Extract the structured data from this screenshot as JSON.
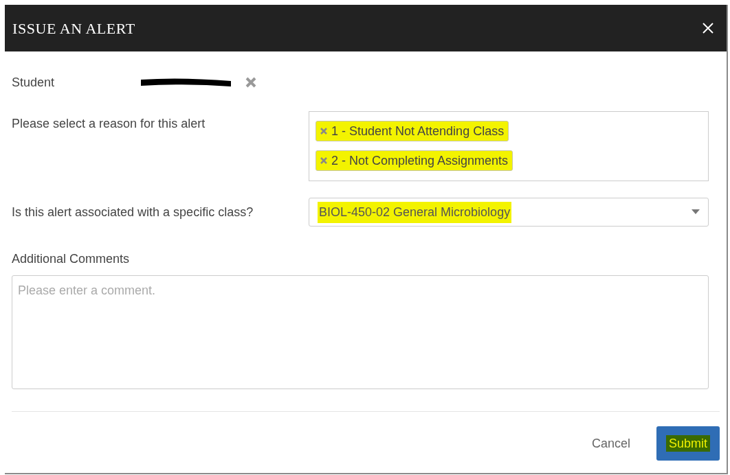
{
  "dialog": {
    "title": "ISSUE AN ALERT"
  },
  "student": {
    "label": "Student",
    "redacted": true
  },
  "reason": {
    "label": "Please select a reason for this alert",
    "tags": [
      {
        "label": "1 - Student Not Attending Class",
        "highlighted": true
      },
      {
        "label": "2 - Not Completing Assignments",
        "highlighted": true
      }
    ]
  },
  "class_select": {
    "label": "Is this alert associated with a specific class?",
    "value": "BIOL-450-02 General Microbiology",
    "highlighted": true
  },
  "comments": {
    "label": "Additional Comments",
    "placeholder": "Please enter a comment."
  },
  "buttons": [
    {
      "kind": "link",
      "label": "Cancel",
      "highlighted": false
    },
    {
      "kind": "primary",
      "label": "Submit",
      "highlighted": true
    }
  ]
}
